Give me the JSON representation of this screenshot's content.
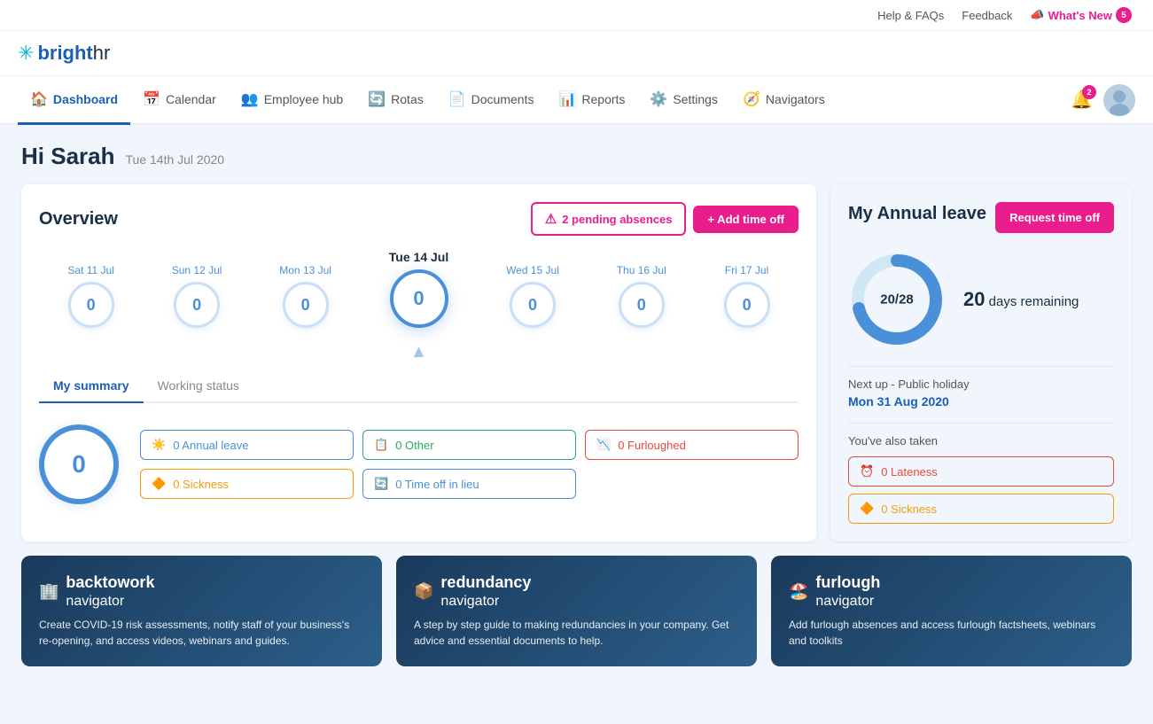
{
  "topbar": {
    "help": "Help & FAQs",
    "feedback": "Feedback",
    "whats_new": "What's New",
    "whats_new_count": "5"
  },
  "nav": {
    "items": [
      {
        "label": "Dashboard",
        "icon": "🏠",
        "active": true
      },
      {
        "label": "Calendar",
        "icon": "📅",
        "active": false
      },
      {
        "label": "Employee hub",
        "icon": "👥",
        "active": false
      },
      {
        "label": "Rotas",
        "icon": "🔄",
        "active": false
      },
      {
        "label": "Documents",
        "icon": "📄",
        "active": false
      },
      {
        "label": "Reports",
        "icon": "📊",
        "active": false
      },
      {
        "label": "Settings",
        "icon": "⚙️",
        "active": false
      },
      {
        "label": "Navigators",
        "icon": "🧭",
        "active": false
      }
    ],
    "notif_count": "2"
  },
  "greeting": {
    "name": "Hi Sarah",
    "date": "Tue 14th Jul 2020"
  },
  "overview": {
    "title": "Overview",
    "pending_label": "2 pending absences",
    "add_time_label": "+ Add time off",
    "calendar": [
      {
        "day": "Sat 11 Jul",
        "value": "0"
      },
      {
        "day": "Sun 12 Jul",
        "value": "0"
      },
      {
        "day": "Mon 13 Jul",
        "value": "0"
      },
      {
        "day": "Tue 14 Jul",
        "value": "0",
        "today": true
      },
      {
        "day": "Wed 15 Jul",
        "value": "0"
      },
      {
        "day": "Thu 16 Jul",
        "value": "0"
      },
      {
        "day": "Fri 17 Jul",
        "value": "0"
      }
    ],
    "tabs": [
      {
        "label": "My summary",
        "active": true
      },
      {
        "label": "Working status",
        "active": false
      }
    ],
    "summary_value": "0",
    "badges": [
      {
        "label": "0 Annual leave",
        "type": "annual",
        "icon": "☀️"
      },
      {
        "label": "0 Other",
        "type": "other",
        "icon": "📋"
      },
      {
        "label": "0 Furloughed",
        "type": "furloughed",
        "icon": "📊"
      },
      {
        "label": "0 Sickness",
        "type": "sickness",
        "icon": "🔶"
      },
      {
        "label": "0 Time off in lieu",
        "type": "toil",
        "icon": "🔄"
      }
    ]
  },
  "annual_leave": {
    "title": "My Annual leave",
    "request_label": "Request time off",
    "donut": {
      "used": 20,
      "total": 28,
      "label": "20/28",
      "remaining": "20",
      "remaining_text": "days remaining"
    },
    "next_up_label": "Next up - Public holiday",
    "holiday_date": "Mon 31 Aug 2020",
    "also_taken_label": "You've also taken",
    "taken": [
      {
        "label": "0 Lateness",
        "type": "lateness",
        "icon": "⏰"
      },
      {
        "label": "0 Sickness",
        "type": "sickness",
        "icon": "🔶"
      }
    ]
  },
  "bottom_cards": [
    {
      "id": "backtowork",
      "icon": "🏢",
      "title_main": "backtowork",
      "title_sub": "navigator",
      "desc": "Create COVID-19 risk assessments, notify staff of your business's re-opening, and access videos, webinars and guides."
    },
    {
      "id": "redundancy",
      "icon": "📦",
      "title_main": "redundancy",
      "title_sub": "navigator",
      "desc": "A step by step guide to making redundancies in your company. Get advice and essential documents to help."
    },
    {
      "id": "furlough",
      "icon": "🏖️",
      "title_main": "furlough",
      "title_sub": "navigator",
      "desc": "Add furlough absences and access furlough factsheets, webinars and toolkits"
    }
  ]
}
